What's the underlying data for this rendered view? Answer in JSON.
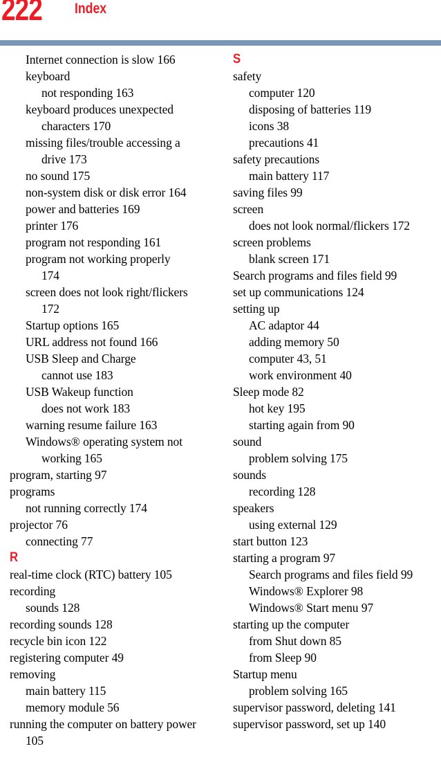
{
  "header": {
    "page_number": "222",
    "title": "Index",
    "rule_color": "#7b96b4",
    "accent_color": "#ed1c24"
  },
  "columns": {
    "left": [
      {
        "kind": "entry",
        "level": 1,
        "text": "Internet connection is slow 166"
      },
      {
        "kind": "entry",
        "level": 1,
        "text": "keyboard"
      },
      {
        "kind": "entry",
        "level": 2,
        "text": "not responding 163"
      },
      {
        "kind": "entry",
        "level": 1,
        "text": "keyboard produces unexpected"
      },
      {
        "kind": "entry",
        "level": 2,
        "text": "characters 170"
      },
      {
        "kind": "entry",
        "level": 1,
        "text": "missing files/trouble accessing a"
      },
      {
        "kind": "entry",
        "level": 2,
        "text": "drive 173"
      },
      {
        "kind": "entry",
        "level": 1,
        "text": "no sound 175"
      },
      {
        "kind": "entry",
        "level": 1,
        "text": "non-system disk or disk error 164"
      },
      {
        "kind": "entry",
        "level": 1,
        "text": "power and batteries 169"
      },
      {
        "kind": "entry",
        "level": 1,
        "text": "printer 176"
      },
      {
        "kind": "entry",
        "level": 1,
        "text": "program not responding 161"
      },
      {
        "kind": "entry",
        "level": 1,
        "text": "program not working properly"
      },
      {
        "kind": "entry",
        "level": 2,
        "text": "174"
      },
      {
        "kind": "entry",
        "level": 1,
        "text": "screen does not look right/flickers"
      },
      {
        "kind": "entry",
        "level": 2,
        "text": "172"
      },
      {
        "kind": "entry",
        "level": 1,
        "text": "Startup options 165"
      },
      {
        "kind": "entry",
        "level": 1,
        "text": "URL address not found 166"
      },
      {
        "kind": "entry",
        "level": 1,
        "text": "USB Sleep and Charge"
      },
      {
        "kind": "entry",
        "level": 2,
        "text": "cannot use 183"
      },
      {
        "kind": "entry",
        "level": 1,
        "text": "USB Wakeup function"
      },
      {
        "kind": "entry",
        "level": 2,
        "text": "does not work 183"
      },
      {
        "kind": "entry",
        "level": 1,
        "text": "warning resume failure 163"
      },
      {
        "kind": "entry",
        "level": 1,
        "text": "Windows® operating system not"
      },
      {
        "kind": "entry",
        "level": 2,
        "text": "working 165"
      },
      {
        "kind": "entry",
        "level": 0,
        "text": "program, starting 97"
      },
      {
        "kind": "entry",
        "level": 0,
        "text": "programs"
      },
      {
        "kind": "entry",
        "level": 1,
        "text": "not running correctly 174"
      },
      {
        "kind": "entry",
        "level": 0,
        "text": "projector 76"
      },
      {
        "kind": "entry",
        "level": 1,
        "text": "connecting 77"
      },
      {
        "kind": "heading",
        "level": 0,
        "text": "R"
      },
      {
        "kind": "entry",
        "level": 0,
        "text": "real-time clock (RTC) battery 105"
      },
      {
        "kind": "entry",
        "level": 0,
        "text": "recording"
      },
      {
        "kind": "entry",
        "level": 1,
        "text": "sounds 128"
      },
      {
        "kind": "entry",
        "level": 0,
        "text": "recording sounds 128"
      },
      {
        "kind": "entry",
        "level": 0,
        "text": "recycle bin icon 122"
      },
      {
        "kind": "entry",
        "level": 0,
        "text": "registering computer 49"
      },
      {
        "kind": "entry",
        "level": 0,
        "text": "removing"
      },
      {
        "kind": "entry",
        "level": 1,
        "text": "main battery 115"
      },
      {
        "kind": "entry",
        "level": 1,
        "text": "memory module 56"
      },
      {
        "kind": "entry",
        "level": 0,
        "text": "running the computer on battery power"
      },
      {
        "kind": "entry",
        "level": 1,
        "text": "105"
      }
    ],
    "right": [
      {
        "kind": "heading",
        "level": 0,
        "text": "S"
      },
      {
        "kind": "entry",
        "level": 0,
        "text": "safety"
      },
      {
        "kind": "entry",
        "level": 1,
        "text": "computer 120"
      },
      {
        "kind": "entry",
        "level": 1,
        "text": "disposing of batteries 119"
      },
      {
        "kind": "entry",
        "level": 1,
        "text": "icons 38"
      },
      {
        "kind": "entry",
        "level": 1,
        "text": "precautions 41"
      },
      {
        "kind": "entry",
        "level": 0,
        "text": "safety precautions"
      },
      {
        "kind": "entry",
        "level": 1,
        "text": "main battery 117"
      },
      {
        "kind": "entry",
        "level": 0,
        "text": "saving files 99"
      },
      {
        "kind": "entry",
        "level": 0,
        "text": "screen"
      },
      {
        "kind": "entry",
        "level": 1,
        "text": "does not look normal/flickers 172"
      },
      {
        "kind": "entry",
        "level": 0,
        "text": "screen problems"
      },
      {
        "kind": "entry",
        "level": 1,
        "text": "blank screen 171"
      },
      {
        "kind": "entry",
        "level": 0,
        "text": "Search programs and files field 99"
      },
      {
        "kind": "entry",
        "level": 0,
        "text": "set up communications 124"
      },
      {
        "kind": "entry",
        "level": 0,
        "text": "setting up"
      },
      {
        "kind": "entry",
        "level": 1,
        "text": "AC adaptor 44"
      },
      {
        "kind": "entry",
        "level": 1,
        "text": "adding memory 50"
      },
      {
        "kind": "entry",
        "level": 1,
        "text": "computer 43, 51"
      },
      {
        "kind": "entry",
        "level": 1,
        "text": "work environment 40"
      },
      {
        "kind": "entry",
        "level": 0,
        "text": "Sleep mode 82"
      },
      {
        "kind": "entry",
        "level": 1,
        "text": "hot key 195"
      },
      {
        "kind": "entry",
        "level": 1,
        "text": "starting again from 90"
      },
      {
        "kind": "entry",
        "level": 0,
        "text": "sound"
      },
      {
        "kind": "entry",
        "level": 1,
        "text": "problem solving 175"
      },
      {
        "kind": "entry",
        "level": 0,
        "text": "sounds"
      },
      {
        "kind": "entry",
        "level": 1,
        "text": "recording 128"
      },
      {
        "kind": "entry",
        "level": 0,
        "text": "speakers"
      },
      {
        "kind": "entry",
        "level": 1,
        "text": "using external 129"
      },
      {
        "kind": "entry",
        "level": 0,
        "text": "start button 123"
      },
      {
        "kind": "entry",
        "level": 0,
        "text": "starting a program 97"
      },
      {
        "kind": "entry",
        "level": 1,
        "text": "Search programs and files field 99"
      },
      {
        "kind": "entry",
        "level": 1,
        "text": "Windows® Explorer 98"
      },
      {
        "kind": "entry",
        "level": 1,
        "text": "Windows® Start menu 97"
      },
      {
        "kind": "entry",
        "level": 0,
        "text": "starting up the computer"
      },
      {
        "kind": "entry",
        "level": 1,
        "text": "from Shut down 85"
      },
      {
        "kind": "entry",
        "level": 1,
        "text": "from Sleep 90"
      },
      {
        "kind": "entry",
        "level": 0,
        "text": "Startup menu"
      },
      {
        "kind": "entry",
        "level": 1,
        "text": "problem solving 165"
      },
      {
        "kind": "entry",
        "level": 0,
        "text": "supervisor password, deleting 141"
      },
      {
        "kind": "entry",
        "level": 0,
        "text": "supervisor password, set up 140"
      }
    ]
  }
}
